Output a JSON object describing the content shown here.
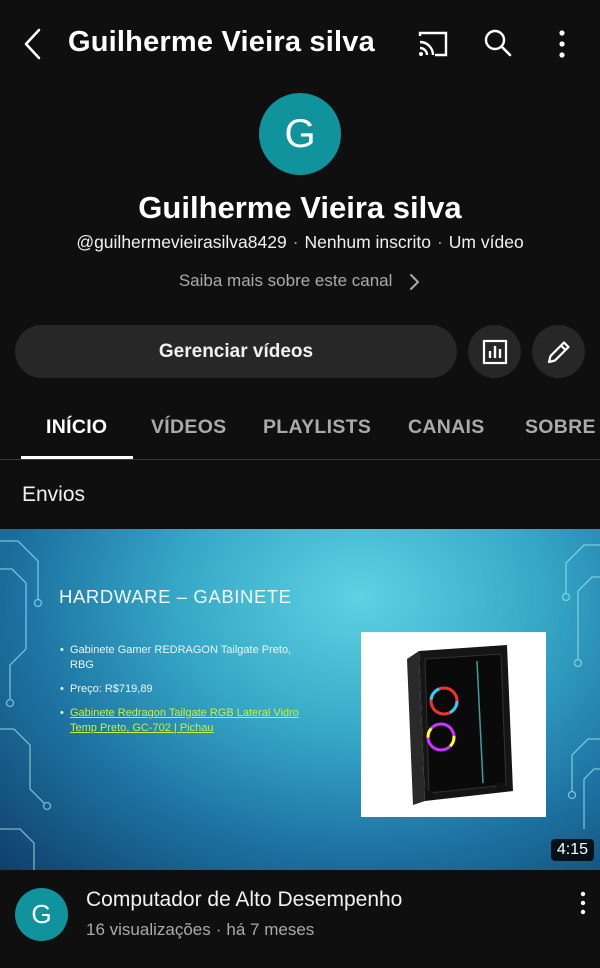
{
  "header": {
    "title": "Guilherme Vieira silva",
    "icons": [
      "back-icon",
      "cast-icon",
      "search-icon",
      "more-vert-icon"
    ]
  },
  "channel": {
    "avatar_letter": "G",
    "avatar_color": "#11939d",
    "name": "Guilherme Vieira silva",
    "handle": "@guilhermevieirasilva8429",
    "subscribers": "Nenhum inscrito",
    "video_count": "Um vídeo",
    "separator": "·",
    "more_about": "Saiba mais sobre este canal"
  },
  "actions": {
    "manage_label": "Gerenciar vídeos",
    "stats_icon": "analytics-icon",
    "edit_icon": "pencil-icon"
  },
  "tabs": [
    {
      "label": "INÍCIO",
      "active": true
    },
    {
      "label": "VÍDEOS",
      "active": false
    },
    {
      "label": "PLAYLISTS",
      "active": false
    },
    {
      "label": "CANAIS",
      "active": false
    },
    {
      "label": "SOBRE",
      "active": false
    }
  ],
  "section": {
    "title": "Envios"
  },
  "video": {
    "thumbnail": {
      "heading": "HARDWARE – GABINETE",
      "bullets": [
        "Gabinete Gamer REDRAGON Tailgate Preto, RBG",
        "Preço: R$719,89"
      ],
      "link": "Gabinete Redragon Tailgate RGB Lateral Vidro Temp Preto, GC-702 | Pichau"
    },
    "duration": "4:15",
    "avatar_letter": "G",
    "title": "Computador de Alto Desempenho",
    "views": "16 visualizações",
    "age": "há 7 meses",
    "separator": "·"
  },
  "colors": {
    "background": "#0f0f0f",
    "button": "#272727",
    "muted_text": "#aaaaaa",
    "avatar": "#11939d"
  }
}
